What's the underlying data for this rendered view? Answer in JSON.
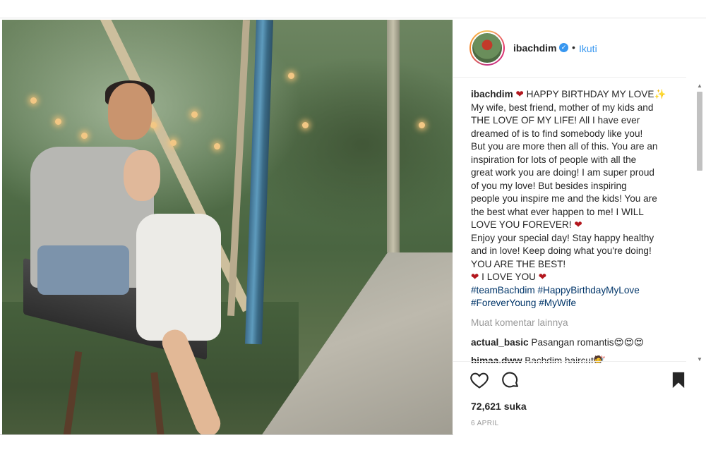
{
  "post": {
    "username": "ibachdim",
    "verified_badge": "✓",
    "separator": "•",
    "follow_label": "Ikuti",
    "caption_user": "ibachdim",
    "caption_lines": [
      "My wife, best friend, mother of my kids and",
      "THE LOVE OF MY LIFE! All I have ever",
      "dreamed of is to find somebody like you!",
      "But you are more then all of this. You are an",
      "inspiration for lots of people with all the",
      "great work you are doing! I am super proud",
      "of you my love! But besides inspiring",
      "people you inspire me and the kids! You are",
      "the best what ever happen to me! I WILL"
    ],
    "caption_first": "HAPPY BIRTHDAY MY LOVE",
    "caption_love_forever": "LOVE YOU FOREVER!",
    "caption_enjoy": [
      "Enjoy your special day! Stay happy healthy",
      "and in love! Keep doing what you're doing!",
      "YOU ARE THE BEST!"
    ],
    "caption_i_love_you": "I LOVE YOU",
    "hashtags_line1": "#teamBachdim #HappyBirthdayMyLove",
    "hashtags_line2": "#ForeverYoung #MyWife",
    "load_more": "Muat komentar lainnya",
    "comments": [
      {
        "user": "actual_basic",
        "text": "Pasangan romantis😍😍😍"
      },
      {
        "user": "bimaa.dww",
        "text": "Bachdim haircut💇"
      }
    ],
    "likes": "72,621 suka",
    "date": "6 APRIL"
  },
  "icons": {
    "heart": "heart-icon",
    "comment": "comment-icon",
    "bookmark": "bookmark-icon",
    "verified": "verified-icon"
  },
  "colors": {
    "link": "#3897f0",
    "hashtag": "#003569",
    "heart": "#b3171e",
    "muted": "#999999"
  }
}
